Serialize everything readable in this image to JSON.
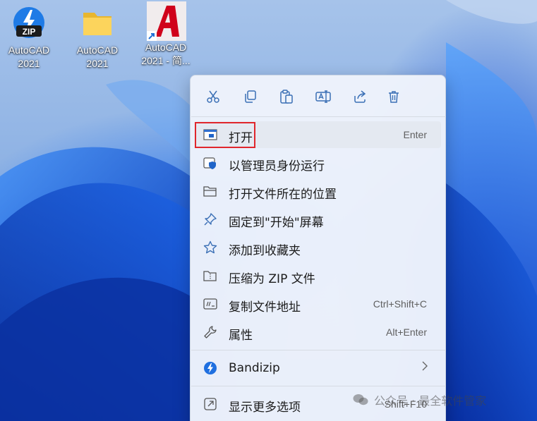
{
  "desktop": {
    "icons": [
      {
        "name": "AutoCAD 2021",
        "label": "AutoCAD\n2021",
        "icon": "zip-archive-icon"
      },
      {
        "name": "AutoCAD 2021 folder",
        "label": "AutoCAD\n2021",
        "icon": "folder-icon"
      },
      {
        "name": "AutoCAD 2021 shortcut",
        "label": "AutoCAD\n2021 - 简...",
        "icon": "autocad-app-icon"
      }
    ]
  },
  "context_menu": {
    "toolbar": [
      {
        "action": "cut",
        "icon": "scissors-icon"
      },
      {
        "action": "copy",
        "icon": "copy-icon"
      },
      {
        "action": "paste",
        "icon": "paste-icon"
      },
      {
        "action": "rename",
        "icon": "rename-icon"
      },
      {
        "action": "share",
        "icon": "share-icon"
      },
      {
        "action": "delete",
        "icon": "trash-icon"
      }
    ],
    "items": [
      {
        "label": "打开",
        "accel": "Enter",
        "icon": "open-app-icon"
      },
      {
        "label": "以管理员身份运行",
        "accel": "",
        "icon": "admin-shield-icon"
      },
      {
        "label": "打开文件所在的位置",
        "accel": "",
        "icon": "folder-open-icon"
      },
      {
        "label": "固定到\"开始\"屏幕",
        "accel": "",
        "icon": "pin-icon"
      },
      {
        "label": "添加到收藏夹",
        "accel": "",
        "icon": "star-icon"
      },
      {
        "label": "压缩为 ZIP 文件",
        "accel": "",
        "icon": "zip-folder-icon"
      },
      {
        "label": "复制文件地址",
        "accel": "Ctrl+Shift+C",
        "icon": "copy-path-icon"
      },
      {
        "label": "属性",
        "accel": "Alt+Enter",
        "icon": "wrench-icon"
      },
      {
        "label": "Bandizip",
        "accel": "",
        "icon": "bandizip-icon",
        "submenu": true
      },
      {
        "label": "显示更多选项",
        "accel": "Shift+F10",
        "icon": "more-options-icon"
      }
    ]
  },
  "watermark": {
    "text": "公众号 · 最全软件管家"
  },
  "colors": {
    "accent": "#0067c0",
    "highlight_border": "#e0262c",
    "menu_bg": "#eef3fb"
  }
}
